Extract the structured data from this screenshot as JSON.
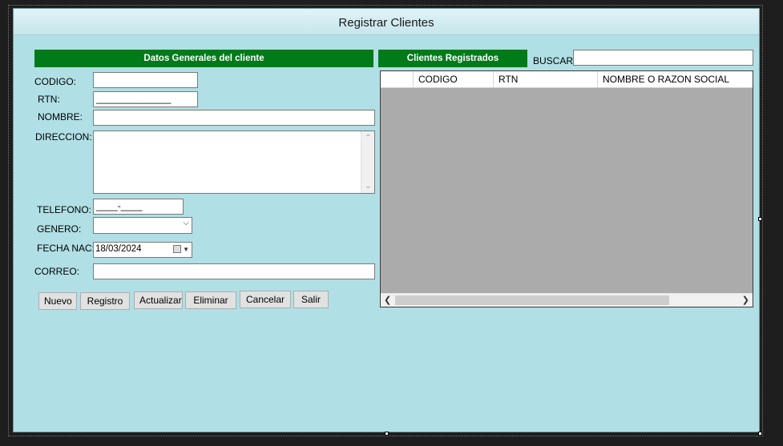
{
  "window": {
    "title": "Registrar Clientes"
  },
  "left_panel": {
    "header": "Datos Generales del cliente",
    "labels": {
      "codigo": "CODIGO:",
      "rtn": "RTN:",
      "nombre": "NOMBRE:",
      "direccion": "DIRECCION:",
      "telefono": "TELEFONO:",
      "genero": "GENERO:",
      "fecha_nac": "FECHA NAC:",
      "correo": "CORREO:"
    },
    "values": {
      "codigo": "",
      "rtn_mask": "______________",
      "nombre": "",
      "direccion": "",
      "telefono_mask": "____-____",
      "genero": "",
      "fecha_nac": "18/03/2024",
      "correo": ""
    }
  },
  "buttons": {
    "nuevo": "Nuevo",
    "registro": "Registro",
    "actualizar": "Actualizar",
    "eliminar": "Eliminar",
    "cancelar": "Cancelar",
    "salir": "Salir"
  },
  "right_panel": {
    "header": "Clientes Registrados",
    "search_label": "BUSCAR:",
    "search_value": "",
    "grid_columns": [
      "",
      "CODIGO",
      "RTN",
      "NOMBRE O RAZON SOCIAL"
    ]
  },
  "icons": {
    "dropdown": "chevron-down-icon",
    "calendar": "calendar-icon",
    "scroll_left": "arrow-left-icon",
    "scroll_right": "arrow-right-icon",
    "scroll_up": "arrow-up-icon",
    "scroll_down": "arrow-down-icon"
  },
  "colors": {
    "form_background": "#b0dfe5",
    "header_green": "#017a1a",
    "grid_background": "#ababab"
  }
}
